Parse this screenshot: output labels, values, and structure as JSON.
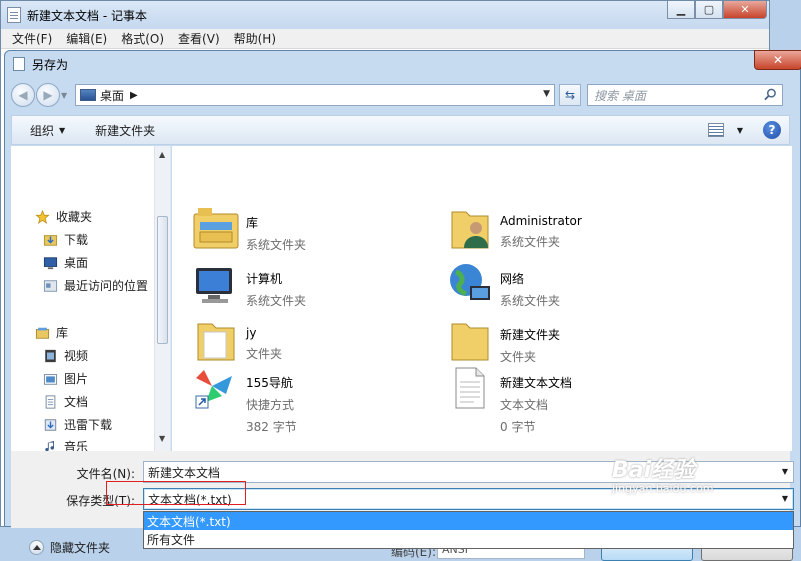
{
  "notepad": {
    "title": "新建文本文档 - 记事本",
    "menus": [
      "文件(F)",
      "编辑(E)",
      "格式(O)",
      "查看(V)",
      "帮助(H)"
    ]
  },
  "dialog": {
    "title": "另存为",
    "address": "桌面",
    "search_placeholder": "搜索 桌面",
    "toolbar": {
      "organize": "组织",
      "new_folder": "新建文件夹"
    },
    "nav": {
      "favorites": "收藏夹",
      "downloads": "下载",
      "desktop": "桌面",
      "recent": "最近访问的位置",
      "libraries": "库",
      "videos": "视频",
      "pictures": "图片",
      "documents": "文档",
      "thunder": "迅雷下载",
      "music": "音乐"
    },
    "files": [
      {
        "name": "库",
        "sub1": "系统文件夹",
        "sub2": "",
        "icon": "library-icon"
      },
      {
        "name": "Administrator",
        "sub1": "系统文件夹",
        "sub2": "",
        "icon": "user-folder-icon"
      },
      {
        "name": "计算机",
        "sub1": "系统文件夹",
        "sub2": "",
        "icon": "computer-icon"
      },
      {
        "name": "网络",
        "sub1": "系统文件夹",
        "sub2": "",
        "icon": "network-icon"
      },
      {
        "name": "jy",
        "sub1": "文件夹",
        "sub2": "",
        "icon": "folder-icon"
      },
      {
        "name": "新建文件夹",
        "sub1": "文件夹",
        "sub2": "",
        "icon": "folder-icon"
      },
      {
        "name": "155导航",
        "sub1": "快捷方式",
        "sub2": "382 字节",
        "icon": "shortcut-icon"
      },
      {
        "name": "新建文本文档",
        "sub1": "文本文档",
        "sub2": "0 字节",
        "icon": "text-file-icon"
      }
    ],
    "filename_label": "文件名(N):",
    "filename_value": "新建文本文档",
    "savetype_label": "保存类型(T):",
    "savetype_value": "文本文档(*.txt)",
    "savetype_options": [
      "文本文档(*.txt)",
      "所有文件"
    ],
    "hide_folders": "隐藏文件夹",
    "encoding_label": "编码(E):",
    "encoding_value": "ANSI"
  },
  "watermark": {
    "logo": "Bai经验",
    "url": "jingyan.baidu.com"
  }
}
